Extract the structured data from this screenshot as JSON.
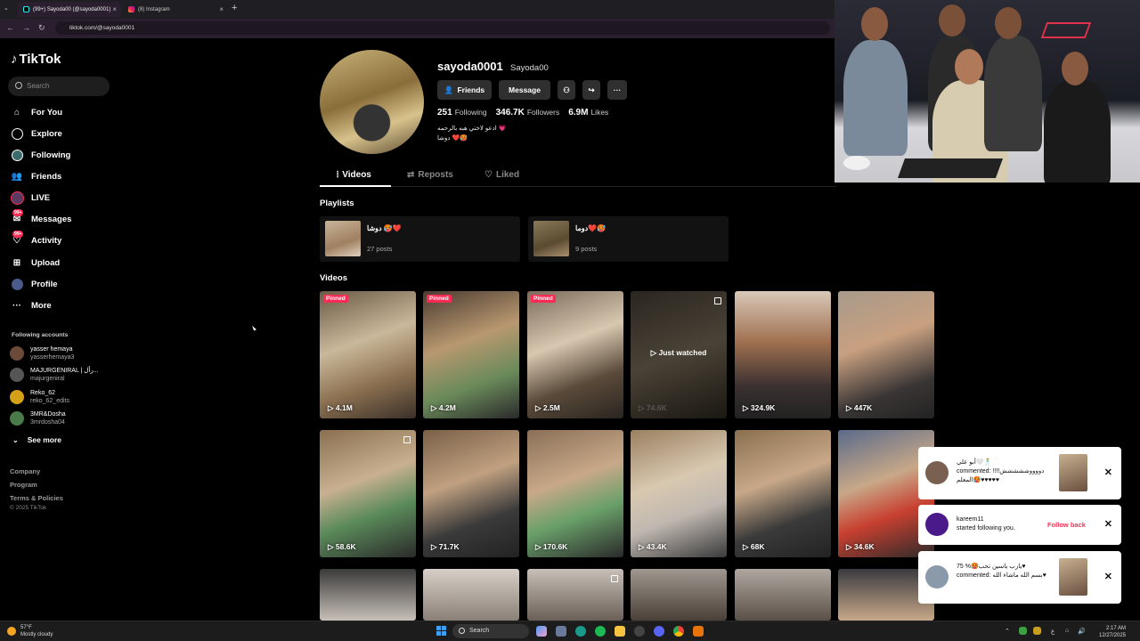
{
  "browser": {
    "tabs": [
      {
        "title": "(99+) Sayoda00 (@sayoda0001)",
        "close": "×"
      },
      {
        "title": "(8) Instagram",
        "close": "×"
      }
    ],
    "new_tab": "+",
    "url": "tiktok.com/@sayoda0001",
    "nav": {
      "back": "←",
      "forward": "→",
      "reload": "↻",
      "menu": "⌄"
    }
  },
  "sidebar": {
    "logo": "TikTok",
    "search_placeholder": "Search",
    "items": [
      {
        "label": "For You",
        "icon": "home-icon"
      },
      {
        "label": "Explore",
        "icon": "compass-icon"
      },
      {
        "label": "Following",
        "icon": "following-icon"
      },
      {
        "label": "Friends",
        "icon": "friends-icon"
      },
      {
        "label": "LIVE",
        "icon": "live-icon"
      },
      {
        "label": "Messages",
        "icon": "messages-icon",
        "badge": "99+"
      },
      {
        "label": "Activity",
        "icon": "activity-icon",
        "badge": "99+"
      },
      {
        "label": "Upload",
        "icon": "upload-icon"
      },
      {
        "label": "Profile",
        "icon": "profile-icon"
      },
      {
        "label": "More",
        "icon": "more-icon"
      }
    ],
    "following_title": "Following accounts",
    "accounts": [
      {
        "name": "yasser hemaya",
        "handle": "yasserhemaya3"
      },
      {
        "name": "MAJURGENIRAL | رأل...",
        "handle": "majurgeniral"
      },
      {
        "name": "Reko_62",
        "handle": "reko_62_edits"
      },
      {
        "name": "3MR&Dosha",
        "handle": "3mrdosha04"
      }
    ],
    "see_more": "See more",
    "footer": [
      "Company",
      "Program",
      "Terms & Policies"
    ],
    "copyright": "© 2025 TikTok"
  },
  "profile": {
    "username": "sayoda0001",
    "nickname": "Sayoda00",
    "buttons": {
      "friends": "Friends",
      "message": "Message"
    },
    "stats": {
      "following": "251",
      "following_label": "Following",
      "followers": "346.7K",
      "followers_label": "Followers",
      "likes": "6.9M",
      "likes_label": "Likes"
    },
    "bio_line1": "ادعو لاختي هبه بالرحمه 💗",
    "bio_line2": "دوشا ❤️🥵"
  },
  "tabs": [
    "Videos",
    "Reposts",
    "Liked"
  ],
  "playlists_title": "Playlists",
  "playlists": [
    {
      "title": "دوشا 🥵❤️",
      "count": "27 posts"
    },
    {
      "title": "دوما❤️🥵",
      "count": "9 posts"
    }
  ],
  "videos_title": "Videos",
  "videos": [
    {
      "views": "4.1M",
      "pinned": "Pinned"
    },
    {
      "views": "4.2M",
      "pinned": "Pinned"
    },
    {
      "views": "2.5M",
      "pinned": "Pinned"
    },
    {
      "views": "74.6K",
      "overlay": "Just watched"
    },
    {
      "views": "324.9K"
    },
    {
      "views": "447K"
    },
    {
      "views": "58.6K"
    },
    {
      "views": "71.7K"
    },
    {
      "views": "170.6K"
    },
    {
      "views": "43.4K"
    },
    {
      "views": "68K"
    },
    {
      "views": "34.6K"
    }
  ],
  "notifications": [
    {
      "name": "أبو علي🤍🕺",
      "text": "commented: !!!!دووووششششش المعلم🥵♥♥♥♥♥"
    },
    {
      "name": "kareem11",
      "text": "started following you.",
      "action": "Follow back"
    },
    {
      "name": "75 %🥵يارب ياسين تحب♥",
      "text": "commented: بسم الله ماشاء الله♥"
    }
  ],
  "taskbar": {
    "weather_temp": "57°F",
    "weather_desc": "Mostly cloudy",
    "search": "Search",
    "time": "2:17 AM",
    "date": "12/27/2025"
  },
  "colors": {
    "accent": "#fe2c55",
    "background": "#000000",
    "card": "#121212"
  }
}
